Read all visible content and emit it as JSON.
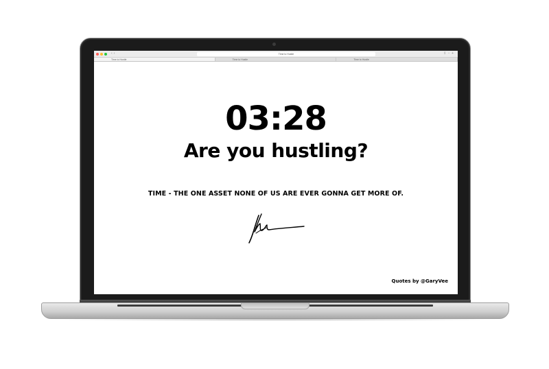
{
  "browser": {
    "address": "Time to Hustle",
    "tabs": [
      "Time to Hustle",
      "Time to Hustle",
      "Time to Hustle"
    ]
  },
  "page": {
    "timer": "03:28",
    "question": "Are you hustling?",
    "quote": "TIME - THE ONE ASSET NONE OF US ARE EVER GONNA GET MORE OF.",
    "credit": "Quotes by @GaryVee"
  },
  "colors": {
    "text": "#000000",
    "background": "#ffffff",
    "bezel": "#1b1b1b"
  },
  "icons": {
    "signature": "signature-icon",
    "window_controls": [
      "close-dot",
      "minimize-dot",
      "zoom-dot"
    ]
  }
}
